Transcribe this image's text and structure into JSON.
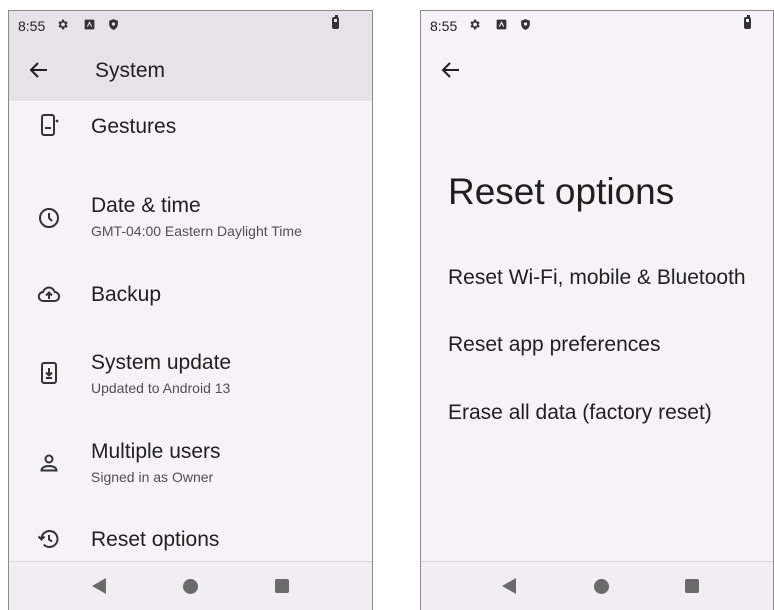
{
  "left_screen": {
    "status": {
      "time": "8:55"
    },
    "header": {
      "title": "System"
    },
    "items": [
      {
        "title": "Gestures",
        "subtitle": "",
        "icon": "phone-gesture-icon"
      },
      {
        "title": "Date & time",
        "subtitle": "GMT-04:00 Eastern Daylight Time",
        "icon": "clock-icon"
      },
      {
        "title": "Backup",
        "subtitle": "",
        "icon": "cloud-upload-icon"
      },
      {
        "title": "System update",
        "subtitle": "Updated to Android 13",
        "icon": "system-update-icon"
      },
      {
        "title": "Multiple users",
        "subtitle": "Signed in as Owner",
        "icon": "person-icon"
      },
      {
        "title": "Reset options",
        "subtitle": "",
        "icon": "history-icon"
      }
    ]
  },
  "right_screen": {
    "status": {
      "time": "8:55"
    },
    "heading": "Reset options",
    "options": [
      "Reset Wi-Fi, mobile & Bluetooth",
      "Reset app preferences",
      "Erase all data (factory reset)"
    ]
  },
  "colors": {
    "app_bar": "#e5e3e8",
    "background": "#f5f3f7",
    "text": "#1f1f1f",
    "secondary_text": "#505050"
  }
}
